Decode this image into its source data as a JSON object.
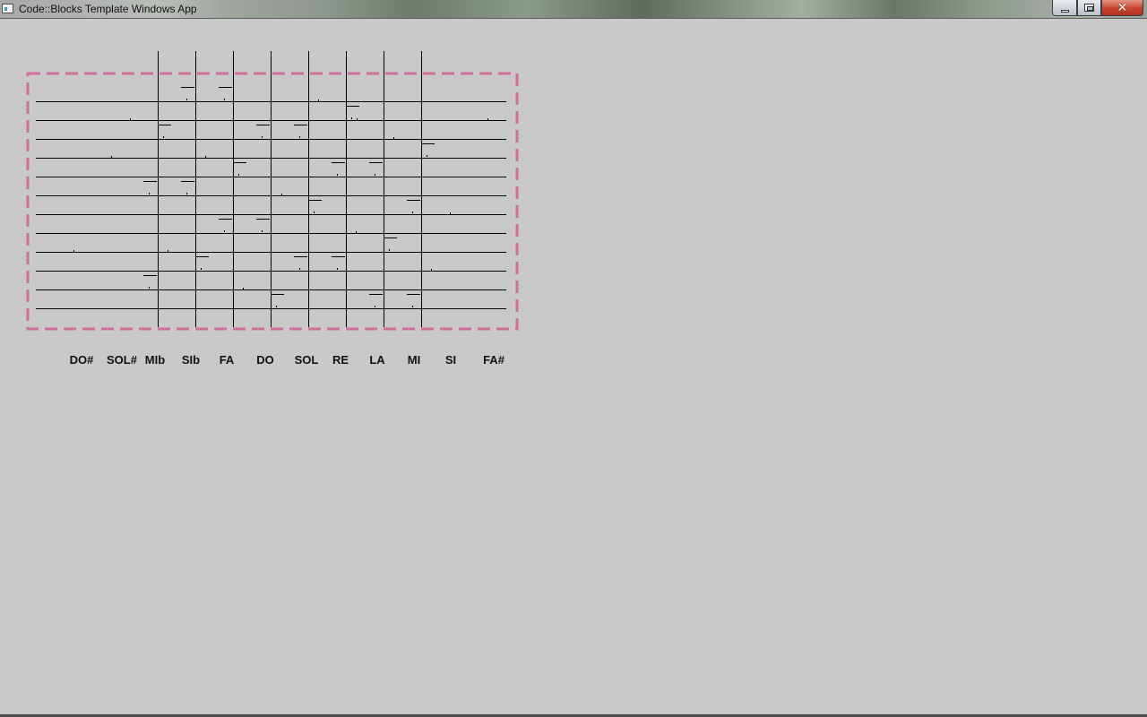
{
  "window": {
    "title": "Code::Blocks Template Windows App",
    "controls": {
      "minimize_icon": "minimize-icon",
      "maximize_icon": "restore-icon",
      "close_icon": "close-icon",
      "close_glyph": "✕"
    }
  },
  "colors": {
    "background": "#c9c9c9",
    "frame": "#d0709a",
    "lines": "#000000"
  },
  "note_labels": [
    "DO#",
    "SOL#",
    "MIb",
    "SIb",
    "FA",
    "DO",
    "SOL",
    "RE",
    "LA",
    "MI",
    "SI",
    "FA#"
  ]
}
